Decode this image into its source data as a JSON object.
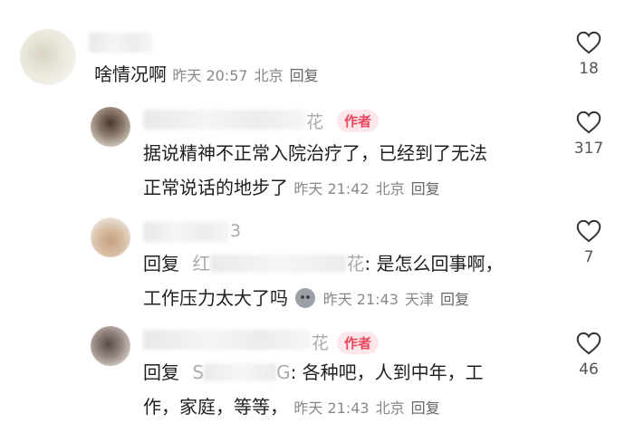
{
  "comments": [
    {
      "text": "啥情况啊",
      "time": "昨天 20:57",
      "location": "北京",
      "reply_label": "回复",
      "likes": "18"
    },
    {
      "name_suffix": "花",
      "badge": "作者",
      "text_line1": "据说精神不正常入院治疗了，已经到了无法",
      "text_line2": "正常说话的地步了",
      "time": "昨天 21:42",
      "location": "北京",
      "reply_label": "回复",
      "likes": "317"
    },
    {
      "name_suffix": "3",
      "reply_prefix": "回复",
      "reply_target_start": "红",
      "reply_target_end": "花",
      "text_line1": ": 是怎么回事啊，",
      "text_line2": "工作压力太大了吗",
      "time": "昨天 21:43",
      "location": "天津",
      "reply_label": "回复",
      "likes": "7"
    },
    {
      "name_suffix": "花",
      "badge": "作者",
      "reply_prefix": "回复",
      "reply_target_start": "S",
      "reply_target_end": "G",
      "text_line1": ": 各种吧，人到中年，工",
      "text_line2": "作，家庭，等等，",
      "time": "昨天 21:43",
      "location": "北京",
      "reply_label": "回复",
      "likes": "46"
    }
  ],
  "icons": {
    "like": "heart-outline-icon",
    "emoji": "emoji-sticker-icon"
  }
}
